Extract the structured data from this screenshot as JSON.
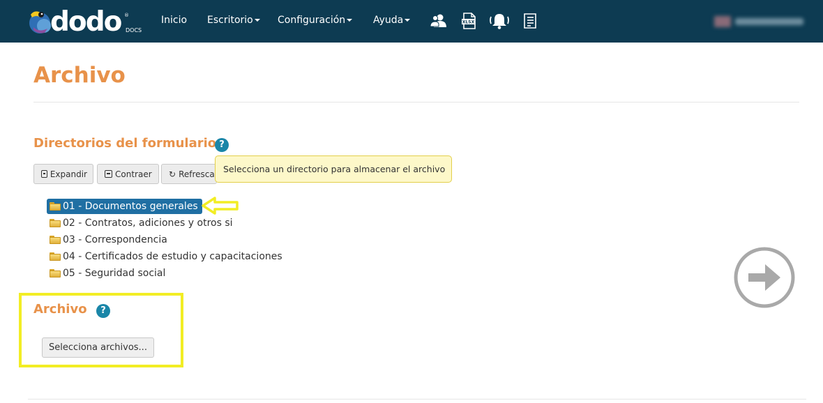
{
  "navbar": {
    "brand": {
      "name": "dodo",
      "sub": "DOCS",
      "reg": "®"
    },
    "menu": [
      {
        "label": "Inicio",
        "has_caret": false
      },
      {
        "label": "Escritorio",
        "has_caret": true
      },
      {
        "label": "Configuración",
        "has_caret": true
      },
      {
        "label": "Ayuda",
        "has_caret": true
      }
    ],
    "icons": [
      "users-icon",
      "xlsx-file-icon",
      "bell-alert-icon",
      "document-list-icon"
    ],
    "user": {
      "name_blurred": true
    }
  },
  "page": {
    "title": "Archivo"
  },
  "directorios": {
    "title": "Directorios del formulario",
    "help": "?",
    "toolbar": {
      "expand_label": "Expandir",
      "collapse_label": "Contraer",
      "refresh_label": "Refrescar"
    },
    "tooltip": "Selecciona un directorio para almacenar el archivo",
    "tree": [
      {
        "label": "01 - Documentos generales",
        "selected": true
      },
      {
        "label": "02 - Contratos, adiciones y otros si",
        "selected": false
      },
      {
        "label": "03 - Correspondencia",
        "selected": false
      },
      {
        "label": "04 - Certificados de estudio y capacitaciones",
        "selected": false
      },
      {
        "label": "05 - Seguridad social",
        "selected": false
      }
    ]
  },
  "archivo": {
    "title": "Archivo",
    "help": "?",
    "file_button_label": "Selecciona archivos..."
  },
  "colors": {
    "navbar_bg": "#0d3b52",
    "accent_orange": "#e8924a",
    "help_blue": "#1a86a8",
    "selected_blue": "#1f6fa3",
    "highlight_yellow": "#f2ed24",
    "tooltip_bg": "#fdf8c9"
  }
}
